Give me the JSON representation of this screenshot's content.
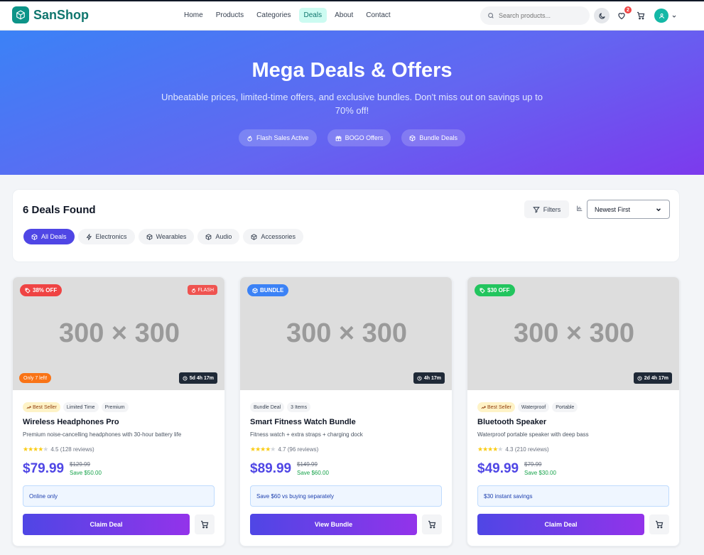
{
  "brand": {
    "name": "SanShop",
    "color": "#0d9488"
  },
  "nav": {
    "items": [
      "Home",
      "Products",
      "Categories",
      "Deals",
      "About",
      "Contact"
    ],
    "active": "Deals"
  },
  "search": {
    "placeholder": "Search products..."
  },
  "header": {
    "wishlist_count": "2"
  },
  "hero": {
    "title": "Mega Deals & Offers",
    "subtitle": "Unbeatable prices, limited-time offers, and exclusive bundles. Don't miss out on savings up to 70% off!",
    "tags": [
      "Flash Sales Active",
      "BOGO Offers",
      "Bundle Deals"
    ]
  },
  "filters": {
    "count_label": "6 Deals Found",
    "filters_button": "Filters",
    "sort_value": "Newest First",
    "categories": [
      "All Deals",
      "Electronics",
      "Wearables",
      "Audio",
      "Accessories"
    ],
    "active_category": "All Deals"
  },
  "cards": [
    {
      "image_text": "300 × 300",
      "discount_label": "38% OFF",
      "discount_color": "#ef4444",
      "flash_label": "FLASH",
      "stock_label": "Only 7 left!",
      "timer": "5d 4h 17m",
      "tags": [
        "Best Seller",
        "Limited Time",
        "Premium"
      ],
      "name": "Wireless Headphones Pro",
      "description": "Premium noise-cancelling headphones with 30-hour battery life",
      "rating": 4.5,
      "rating_text": "4.5 (128 reviews)",
      "price": "$79.99",
      "old_price": "$129.99",
      "save": "Save $50.00",
      "note": "Online only",
      "cta": "Claim Deal"
    },
    {
      "image_text": "300 × 300",
      "discount_label": "BUNDLE",
      "discount_color": "#3b82f6",
      "timer": "4h 17m",
      "tags": [
        "Bundle Deal",
        "3 Items"
      ],
      "name": "Smart Fitness Watch Bundle",
      "description": "Fitness watch + extra straps + charging dock",
      "rating": 4.7,
      "rating_text": "4.7 (96 reviews)",
      "price": "$89.99",
      "old_price": "$149.99",
      "save": "Save $60.00",
      "note": "Save $60 vs buying separately",
      "cta": "View Bundle"
    },
    {
      "image_text": "300 × 300",
      "discount_label": "$30 OFF",
      "discount_color": "#22c55e",
      "timer": "2d 4h 17m",
      "tags": [
        "Best Seller",
        "Waterproof",
        "Portable"
      ],
      "name": "Bluetooth Speaker",
      "description": "Waterproof portable speaker with deep bass",
      "rating": 4.3,
      "rating_text": "4.3 (210 reviews)",
      "price": "$49.99",
      "old_price": "$79.99",
      "save": "Save $30.00",
      "note": "$30 instant savings",
      "cta": "Claim Deal"
    }
  ]
}
